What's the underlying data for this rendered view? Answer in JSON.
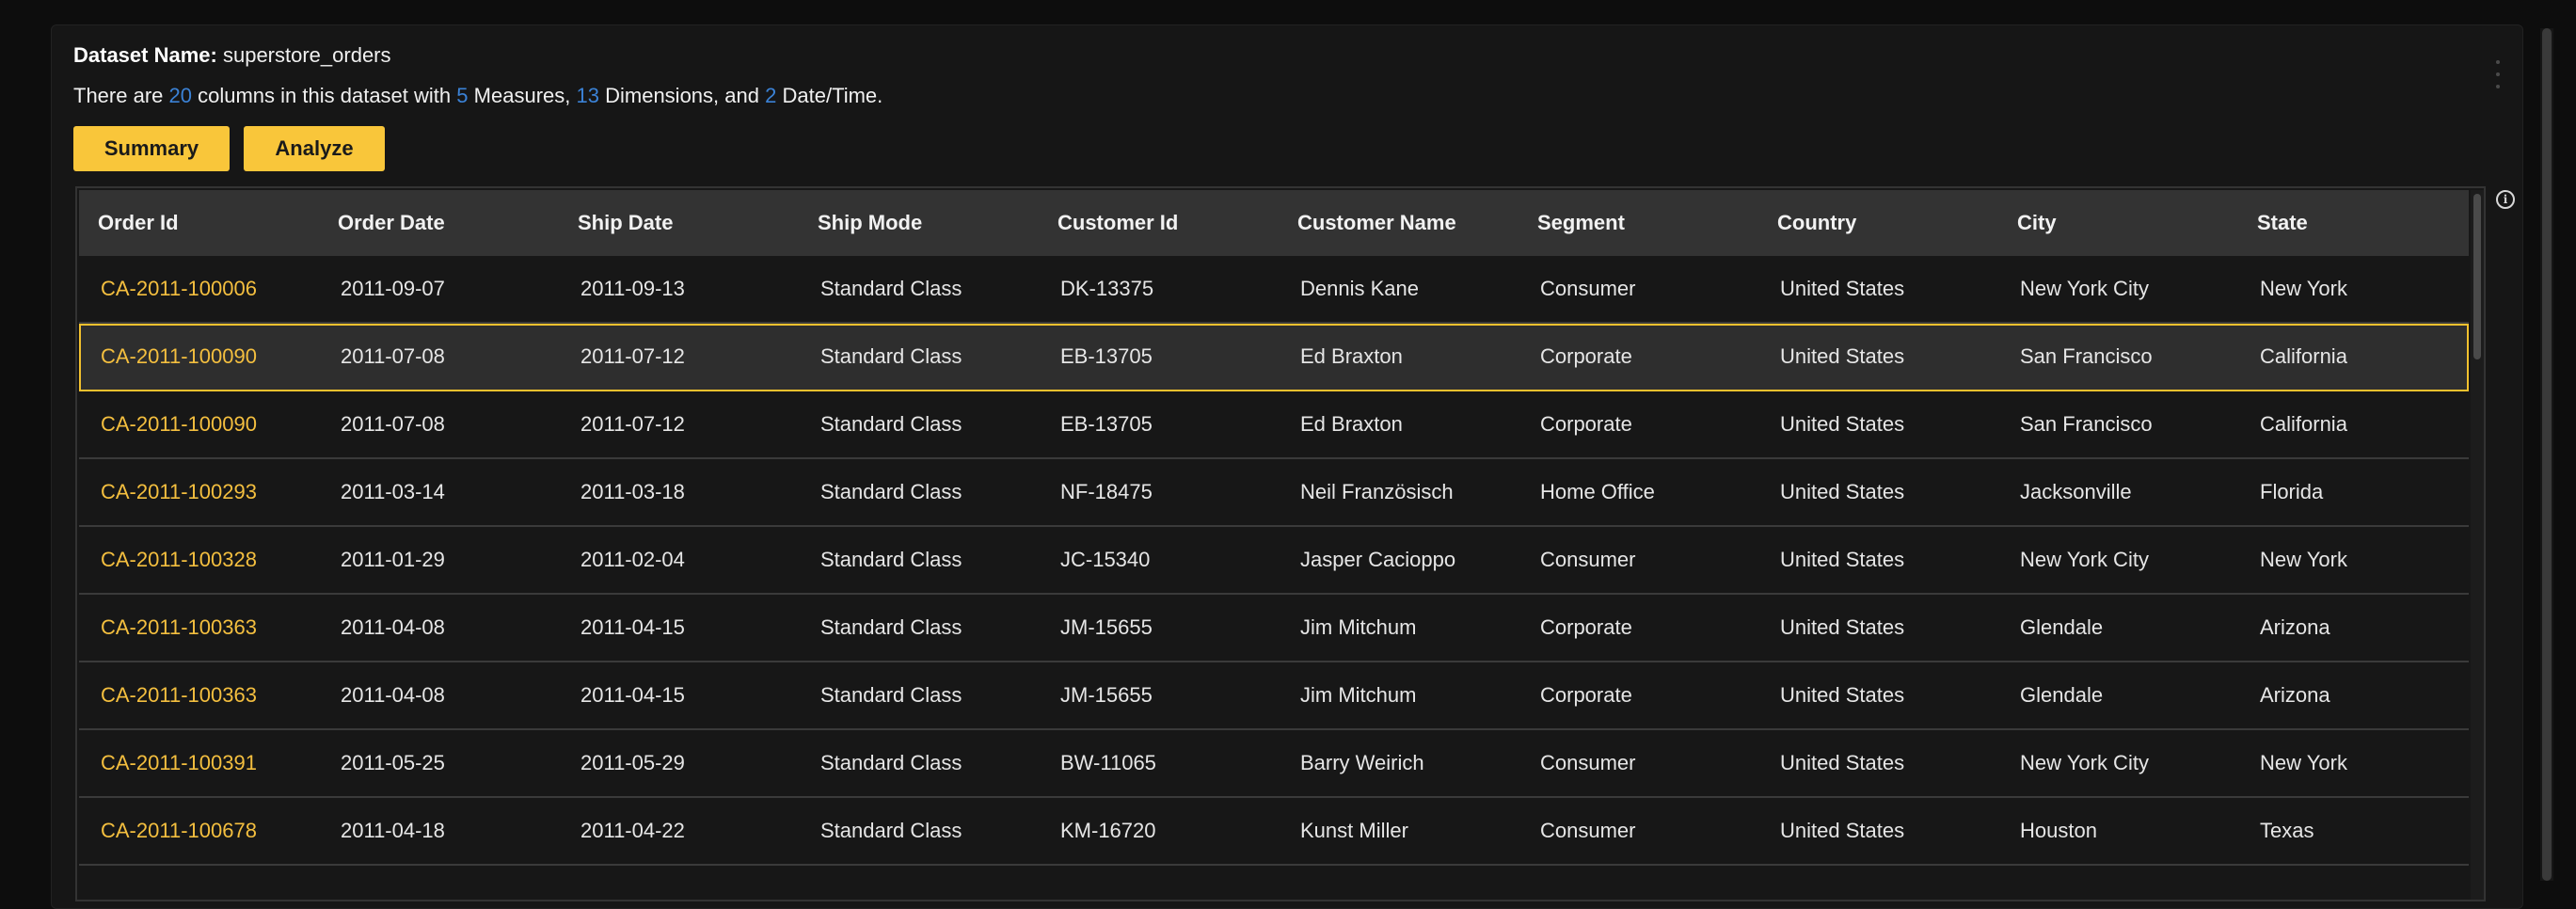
{
  "header": {
    "dataset_label": "Dataset Name:",
    "dataset_name": "superstore_orders",
    "summary_prefix": "There are",
    "column_count": "20",
    "summary_mid1": "columns in this dataset with",
    "measures_count": "5",
    "summary_mid2": "Measures,",
    "dimensions_count": "13",
    "summary_mid3": "Dimensions, and",
    "datetime_count": "2",
    "summary_suffix": "Date/Time."
  },
  "buttons": {
    "summary": "Summary",
    "analyze": "Analyze"
  },
  "icons": {
    "more": "more-vertical-icon",
    "info": "info-icon"
  },
  "colors": {
    "accent": "#f9c63a",
    "link": "#f4bf3f",
    "count": "#3b82d6"
  },
  "table": {
    "columns": [
      "Order Id",
      "Order Date",
      "Ship Date",
      "Ship Mode",
      "Customer Id",
      "Customer Name",
      "Segment",
      "Country",
      "City",
      "State"
    ],
    "selected_row": 1,
    "rows": [
      [
        "CA-2011-100006",
        "2011-09-07",
        "2011-09-13",
        "Standard Class",
        "DK-13375",
        "Dennis Kane",
        "Consumer",
        "United States",
        "New York City",
        "New York"
      ],
      [
        "CA-2011-100090",
        "2011-07-08",
        "2011-07-12",
        "Standard Class",
        "EB-13705",
        "Ed Braxton",
        "Corporate",
        "United States",
        "San Francisco",
        "California"
      ],
      [
        "CA-2011-100090",
        "2011-07-08",
        "2011-07-12",
        "Standard Class",
        "EB-13705",
        "Ed Braxton",
        "Corporate",
        "United States",
        "San Francisco",
        "California"
      ],
      [
        "CA-2011-100293",
        "2011-03-14",
        "2011-03-18",
        "Standard Class",
        "NF-18475",
        "Neil Französisch",
        "Home Office",
        "United States",
        "Jacksonville",
        "Florida"
      ],
      [
        "CA-2011-100328",
        "2011-01-29",
        "2011-02-04",
        "Standard Class",
        "JC-15340",
        "Jasper Cacioppo",
        "Consumer",
        "United States",
        "New York City",
        "New York"
      ],
      [
        "CA-2011-100363",
        "2011-04-08",
        "2011-04-15",
        "Standard Class",
        "JM-15655",
        "Jim Mitchum",
        "Corporate",
        "United States",
        "Glendale",
        "Arizona"
      ],
      [
        "CA-2011-100363",
        "2011-04-08",
        "2011-04-15",
        "Standard Class",
        "JM-15655",
        "Jim Mitchum",
        "Corporate",
        "United States",
        "Glendale",
        "Arizona"
      ],
      [
        "CA-2011-100391",
        "2011-05-25",
        "2011-05-29",
        "Standard Class",
        "BW-11065",
        "Barry Weirich",
        "Consumer",
        "United States",
        "New York City",
        "New York"
      ],
      [
        "CA-2011-100678",
        "2011-04-18",
        "2011-04-22",
        "Standard Class",
        "KM-16720",
        "Kunst Miller",
        "Consumer",
        "United States",
        "Houston",
        "Texas"
      ],
      [
        "",
        "",
        "",
        "",
        "",
        "",
        "",
        "",
        "",
        ""
      ]
    ]
  }
}
